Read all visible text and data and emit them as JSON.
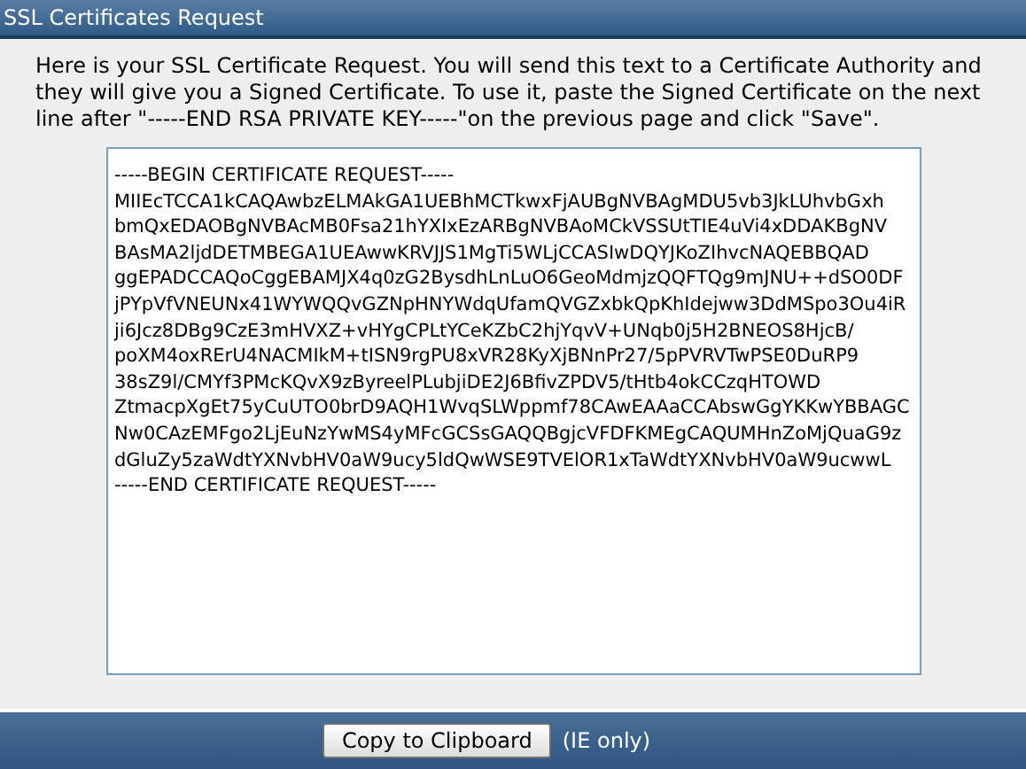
{
  "window": {
    "title": "SSL Certificates Request"
  },
  "intro": "Here is your SSL Certificate Request. You will send this text to a Certificate Authority and they will give you a Signed Certificate. To use it, paste the Signed Certificate on the next line after \"-----END RSA PRIVATE KEY-----\"on the previous page and click \"Save\".",
  "certificate_lines": [
    "-----BEGIN CERTIFICATE REQUEST-----",
    "MIIEcTCCA1kCAQAwbzELMAkGA1UEBhMCTkwxFjAUBgNVBAgMDU5vb3JkLUhvbGxh",
    "bmQxEDAOBgNVBAcMB0Fsa21hYXIxEzARBgNVBAoMCkVSSUtTIE4uVi4xDDAKBgNV",
    "BAsMA2ljdDETMBEGA1UEAwwKRVJJS1MgTi5WLjCCASIwDQYJKoZIhvcNAQEBBQAD",
    "ggEPADCCAQoCggEBAMJX4q0zG2BysdhLnLuO6GeoMdmjzQQFTQg9mJNU++dSO0DF",
    "jPYpVfVNEUNx41WYWQQvGZNpHNYWdqUfamQVGZxbkQpKhIdejww3DdMSpo3Ou4iR",
    "ji6Jcz8DBg9CzE3mHVXZ+vHYgCPLtYCeKZbC2hjYqvV+UNqb0j5H2BNEOS8HjcB/",
    "poXM4oxRErU4NACMIkM+tISN9rgPU8xVR28KyXjBNnPr27/5pPVRVTwPSE0DuRP9",
    "38sZ9l/CMYf3PMcKQvX9zByreelPLubjiDE2J6BfivZPDV5/tHtb4okCCzqHTOWD",
    "ZtmacpXgEt75yCuUTO0brD9AQH1WvqSLWppmf78CAwEAAaCCAbswGgYKKwYBBAGC",
    "Nw0CAzEMFgo2LjEuNzYwMS4yMFcGCSsGAQQBgjcVFDFKMEgCAQUMHnZoMjQuaG9z",
    "dGluZy5zaWdtYXNvbHV0aW9ucy5ldQwWSE9TVElOR1xTaWdtYXNvbHV0aW9ucwwL",
    "-----END CERTIFICATE REQUEST-----"
  ],
  "copy_button": "Copy to Clipboard",
  "copy_note": "(IE only)"
}
